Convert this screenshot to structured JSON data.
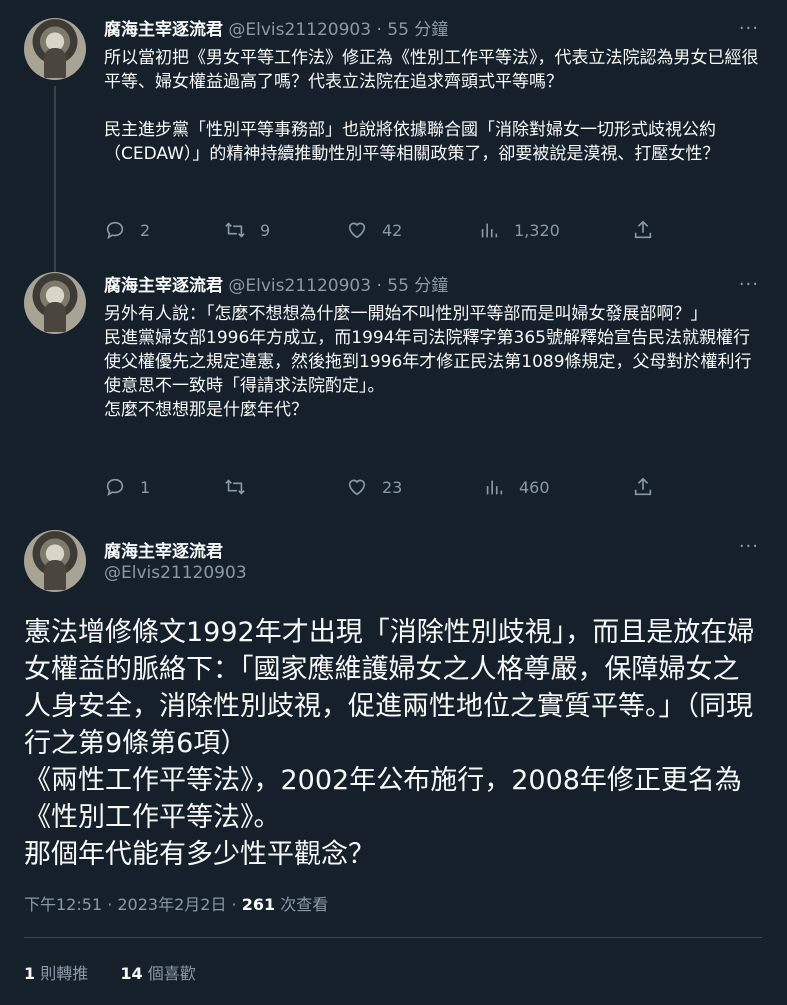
{
  "tweets": [
    {
      "name": "腐海主宰逐流君",
      "handle": "@Elvis21120903",
      "sep": "·",
      "time": "55 分鐘",
      "text": "所以當初把《男女平等工作法》修正為《性別工作平等法》，代表立法院認為男女已經很平等、婦女權益過高了嗎？代表立法院在追求齊頭式平等嗎？\n\n民主進步黨「性別平等事務部」也說將依據聯合國「消除對婦女一切形式歧視公約（CEDAW）」的精神持續推動性別平等相關政策了，卻要被說是漠視、打壓女性？",
      "replies": "2",
      "retweets": "9",
      "likes": "42",
      "views": "1,320"
    },
    {
      "name": "腐海主宰逐流君",
      "handle": "@Elvis21120903",
      "sep": "·",
      "time": "55 分鐘",
      "text": "另外有人說：「怎麼不想想為什麼一開始不叫性別平等部而是叫婦女發展部啊？」\n民進黨婦女部1996年方成立，而1994年司法院釋字第365號解釋始宣告民法就親權行使父權優先之規定違憲，然後拖到1996年才修正民法第1089條規定，父母對於權利行使意思不一致時「得請求法院酌定」。\n怎麼不想想那是什麼年代？",
      "replies": "1",
      "retweets": "",
      "likes": "23",
      "views": "460"
    }
  ],
  "main": {
    "name": "腐海主宰逐流君",
    "handle": "@Elvis21120903",
    "text": "憲法增修條文1992年才出現「消除性別歧視」，而且是放在婦女權益的脈絡下：「國家應維護婦女之人格尊嚴，保障婦女之人身安全，消除性別歧視，促進兩性地位之實質平等。」（同現行之第9條第6項）\n《兩性工作平等法》，2002年公布施行，2008年修正更名為《性別工作平等法》。\n那個年代能有多少性平觀念？",
    "time": "下午12:51 · 2023年2月2日 · ",
    "views_count": "261",
    "views_label": " 次查看",
    "retweet_count": "1",
    "retweet_label": " 則轉推",
    "like_count": "14",
    "like_label": " 個喜歡"
  },
  "more_label": "···",
  "colors": {
    "bg": "#15202b",
    "text": "#f7f9f9",
    "muted": "#8b98a5",
    "border": "#38444d"
  },
  "icons": [
    "reply-icon",
    "retweet-icon",
    "like-icon",
    "views-icon",
    "share-icon",
    "more-icon"
  ]
}
